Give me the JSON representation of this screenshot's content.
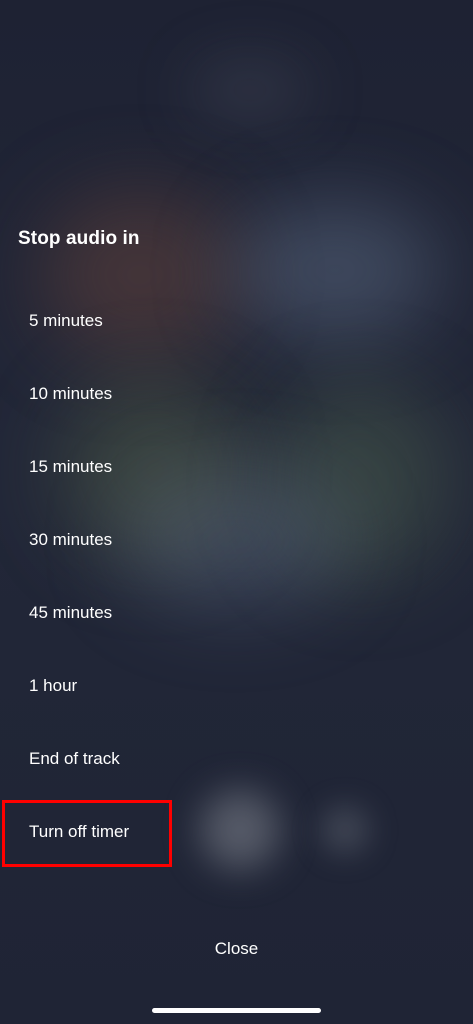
{
  "sleep_timer": {
    "title": "Stop audio in",
    "options": [
      {
        "label": "5 minutes"
      },
      {
        "label": "10 minutes"
      },
      {
        "label": "15 minutes"
      },
      {
        "label": "30 minutes"
      },
      {
        "label": "45 minutes"
      },
      {
        "label": "1 hour"
      },
      {
        "label": "End of track"
      },
      {
        "label": "Turn off timer",
        "highlighted": true
      }
    ],
    "close_label": "Close"
  },
  "colors": {
    "background": "#1d2232",
    "text": "#ffffff",
    "highlight_border": "#ff0000"
  }
}
